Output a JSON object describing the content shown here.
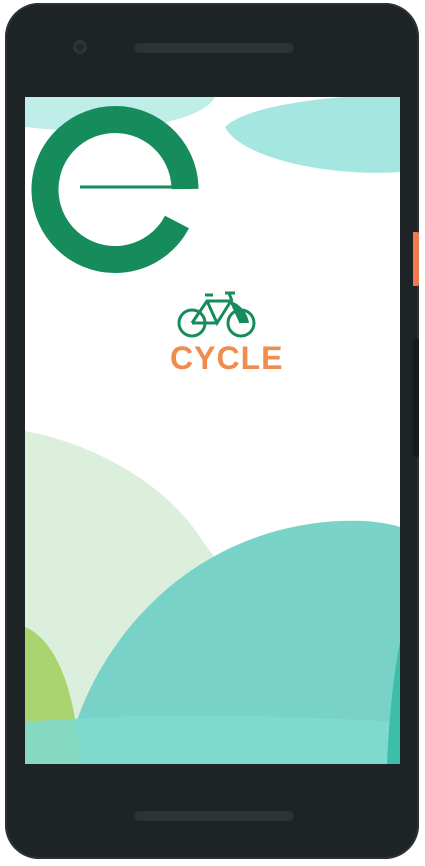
{
  "app": {
    "brand_name": "CYCLE"
  },
  "colors": {
    "brand_green": "#168c5c",
    "brand_orange": "#f08c4c",
    "teal_light": "#a6e6e1",
    "teal_mid": "#6fcfc4",
    "mint": "#d9efdc",
    "lime": "#a9d46f"
  },
  "icons": {
    "logo": "bicycle-icon"
  }
}
